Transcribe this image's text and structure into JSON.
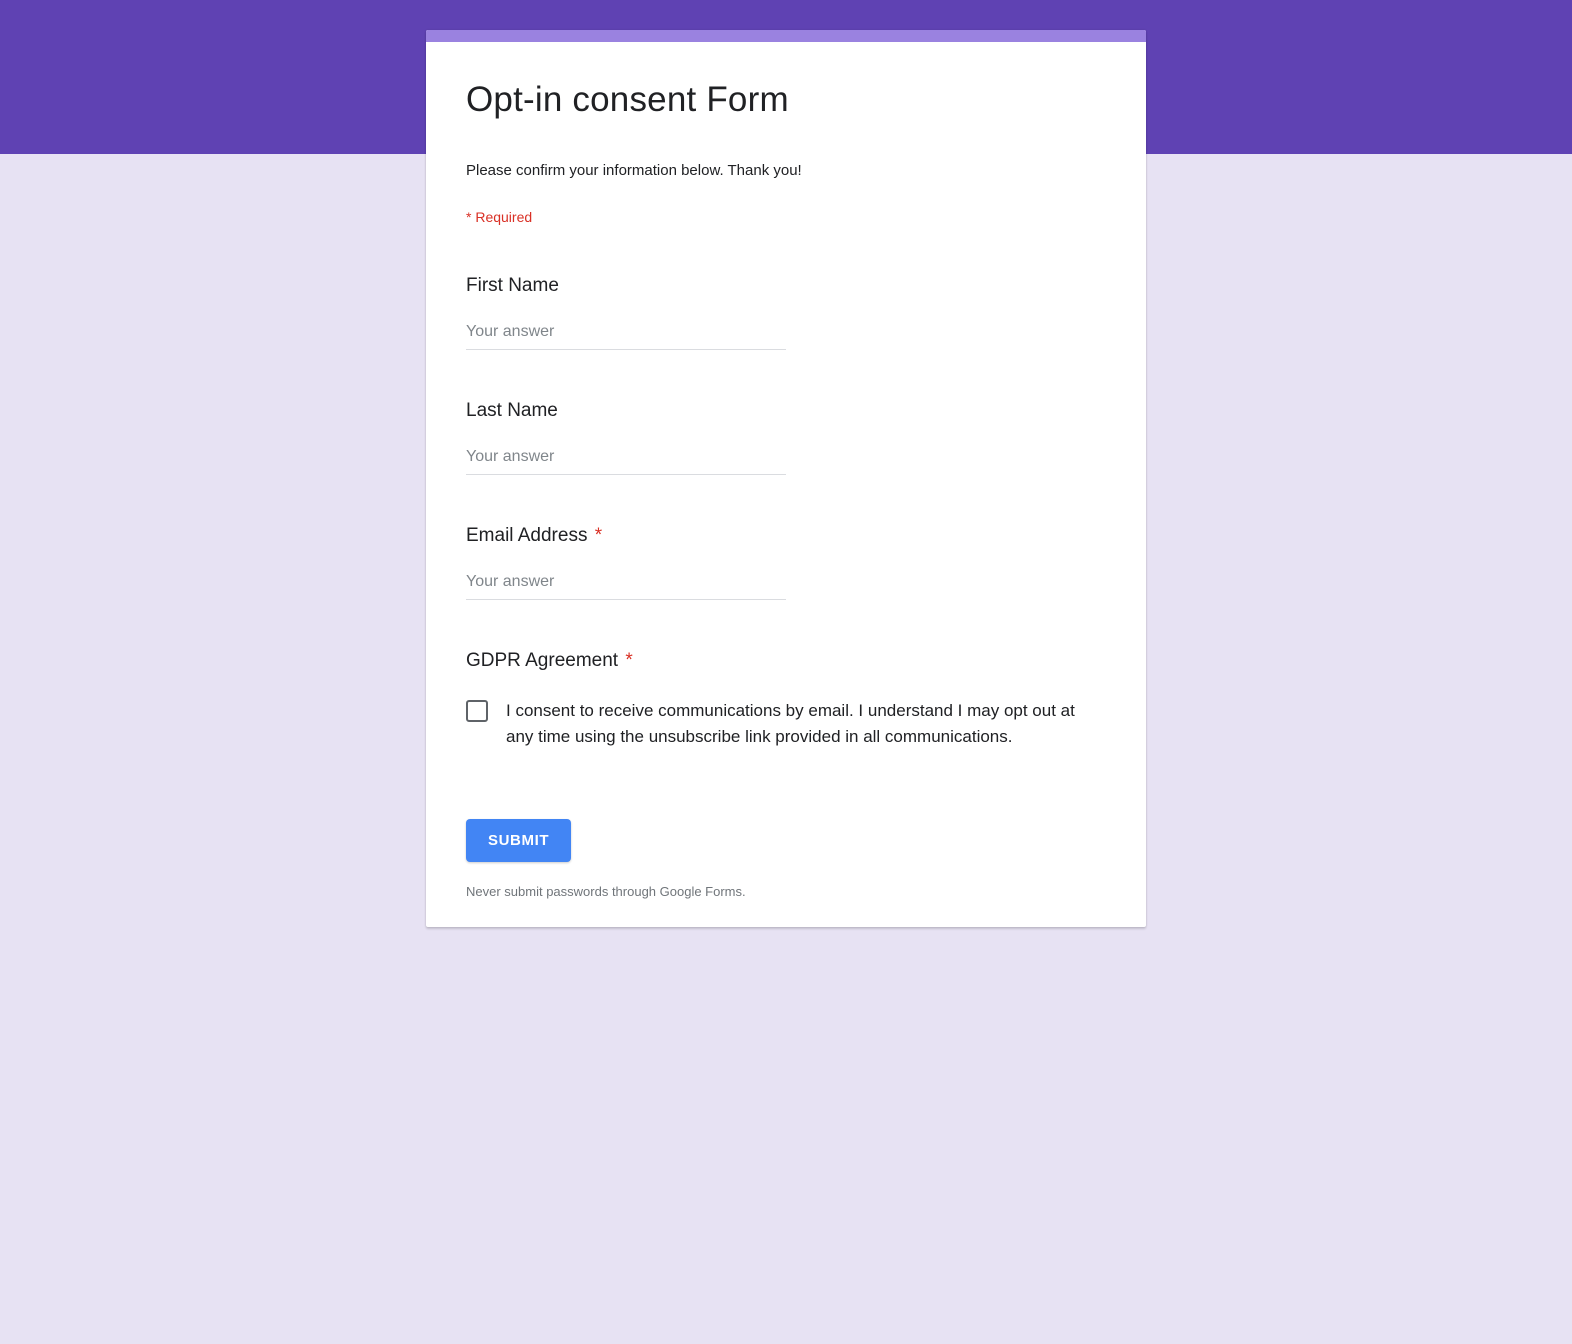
{
  "form": {
    "title": "Opt-in consent Form",
    "description": "Please confirm your information below. Thank you!",
    "required_note": "* Required",
    "submit_label": "SUBMIT",
    "footer_note": "Never submit passwords through Google Forms.",
    "input_placeholder": "Your answer",
    "asterisk": "*"
  },
  "questions": {
    "first_name": {
      "label": "First Name"
    },
    "last_name": {
      "label": "Last Name"
    },
    "email": {
      "label": "Email Address"
    },
    "gdpr": {
      "label": "GDPR Agreement",
      "option": "I consent to receive communications by email. I understand I may opt out at any time using the unsubscribe link provided in all communications."
    }
  }
}
